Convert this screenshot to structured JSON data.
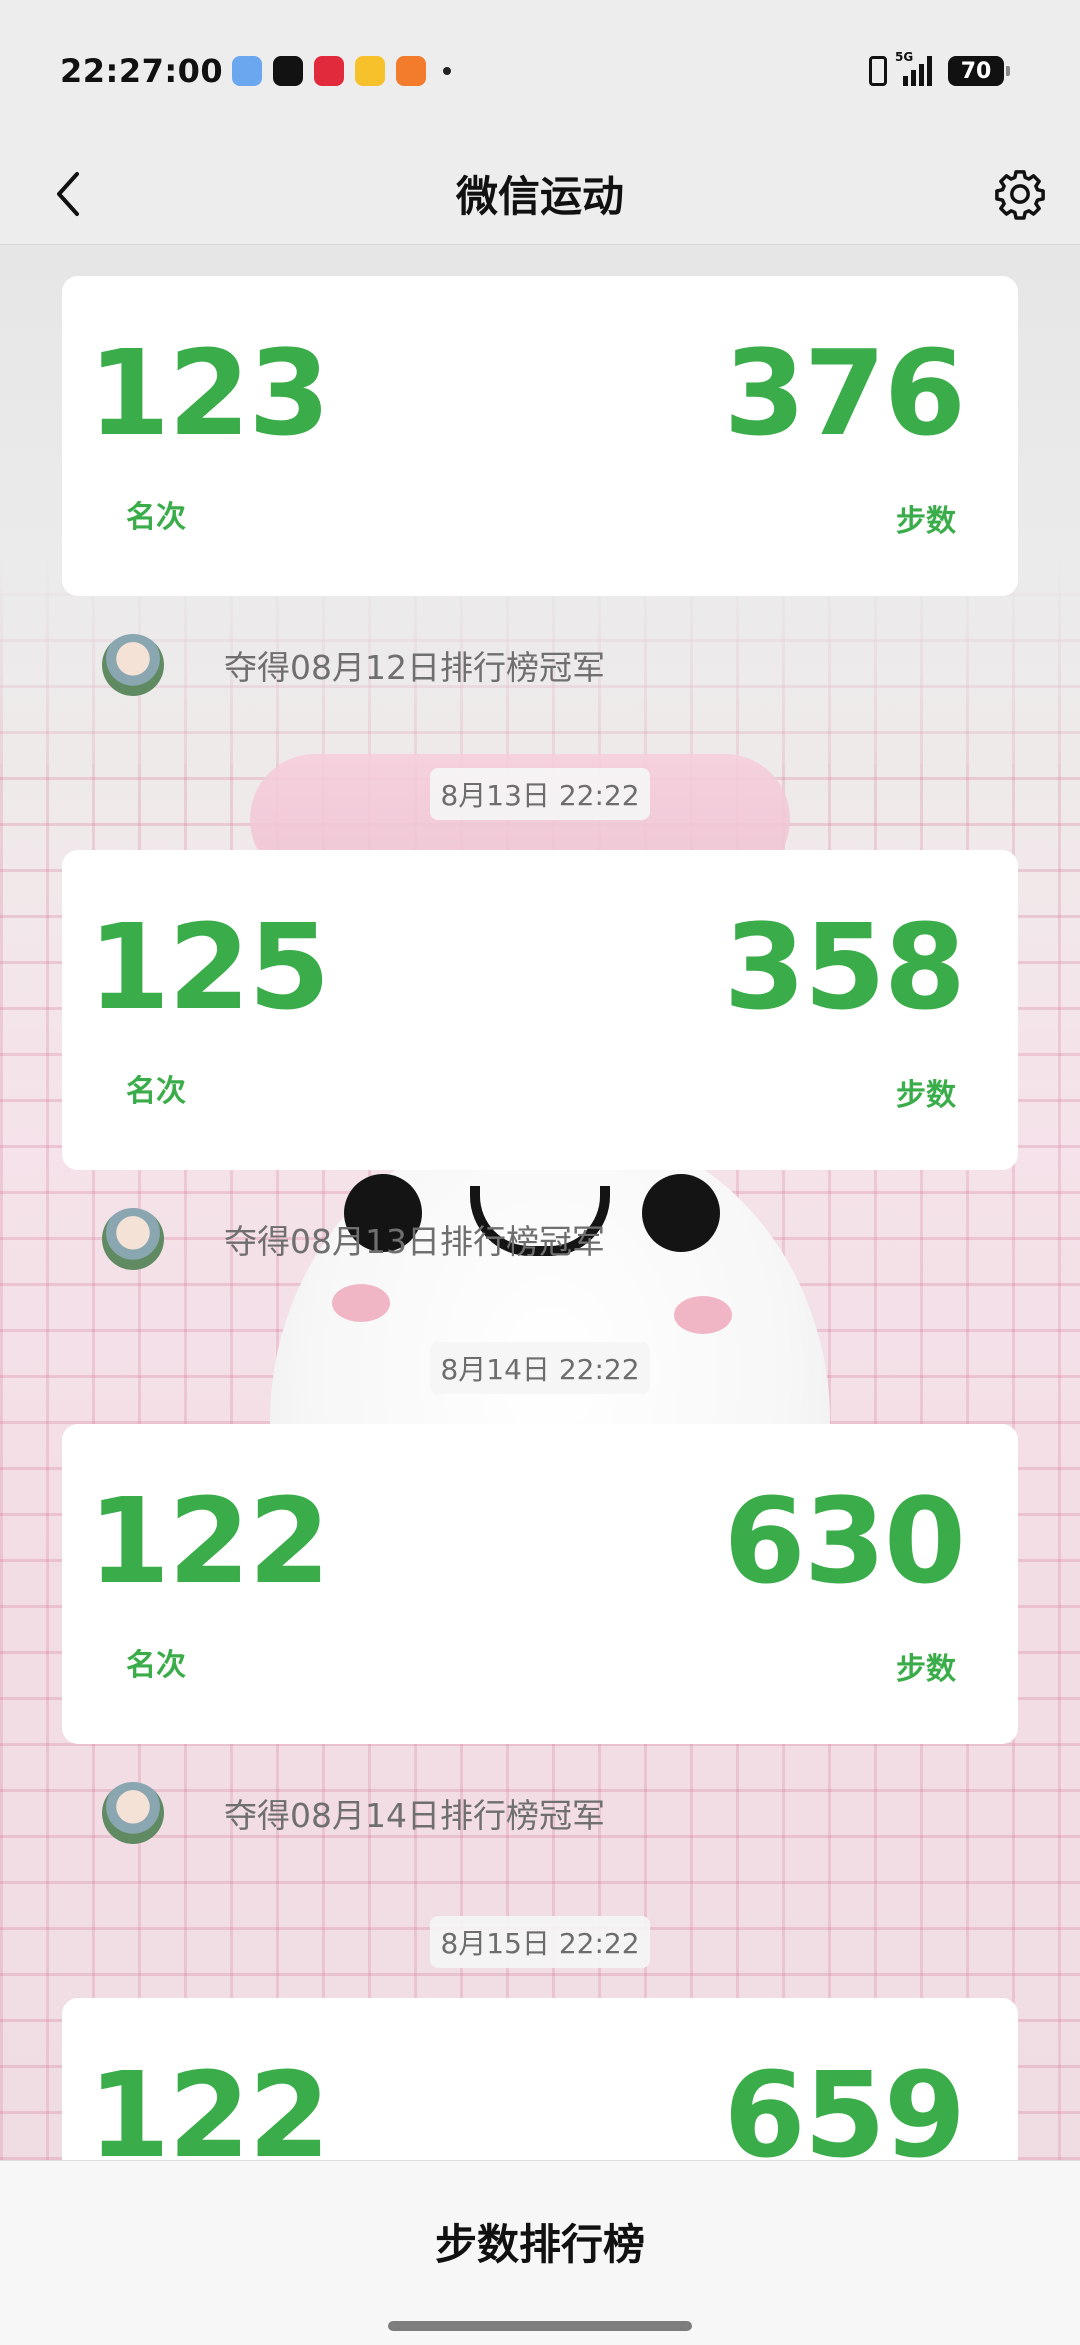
{
  "status_bar": {
    "time": "22:27:00",
    "signal": "5G",
    "battery": "70",
    "app_icons": [
      {
        "name": "weather-app-icon",
        "color": "#6aa7ef"
      },
      {
        "name": "tiktok-app-icon",
        "color": "#121212"
      },
      {
        "name": "heart-app-icon",
        "color": "#e12a3c"
      },
      {
        "name": "weibo-app-icon",
        "color": "#f6c12a"
      },
      {
        "name": "orange-app-icon",
        "color": "#f27b2c"
      }
    ]
  },
  "nav": {
    "title": "微信运动"
  },
  "feed": {
    "cards": [
      {
        "rank": "123",
        "rank_label": "名次",
        "steps": "376",
        "steps_label": "步数"
      },
      {
        "rank": "125",
        "rank_label": "名次",
        "steps": "358",
        "steps_label": "步数"
      },
      {
        "rank": "122",
        "rank_label": "名次",
        "steps": "630",
        "steps_label": "步数"
      },
      {
        "rank": "122",
        "rank_label": "名次",
        "steps": "659",
        "steps_label": "步数"
      }
    ],
    "champions": [
      {
        "text": "夺得08月12日排行榜冠军"
      },
      {
        "text": "夺得08月13日排行榜冠军"
      },
      {
        "text": "夺得08月14日排行榜冠军"
      }
    ],
    "timestamps": [
      "8月13日 22:22",
      "8月14日 22:22",
      "8月15日 22:22"
    ]
  },
  "bottom": {
    "title": "步数排行榜"
  },
  "colors": {
    "accent": "#3aad4a"
  }
}
